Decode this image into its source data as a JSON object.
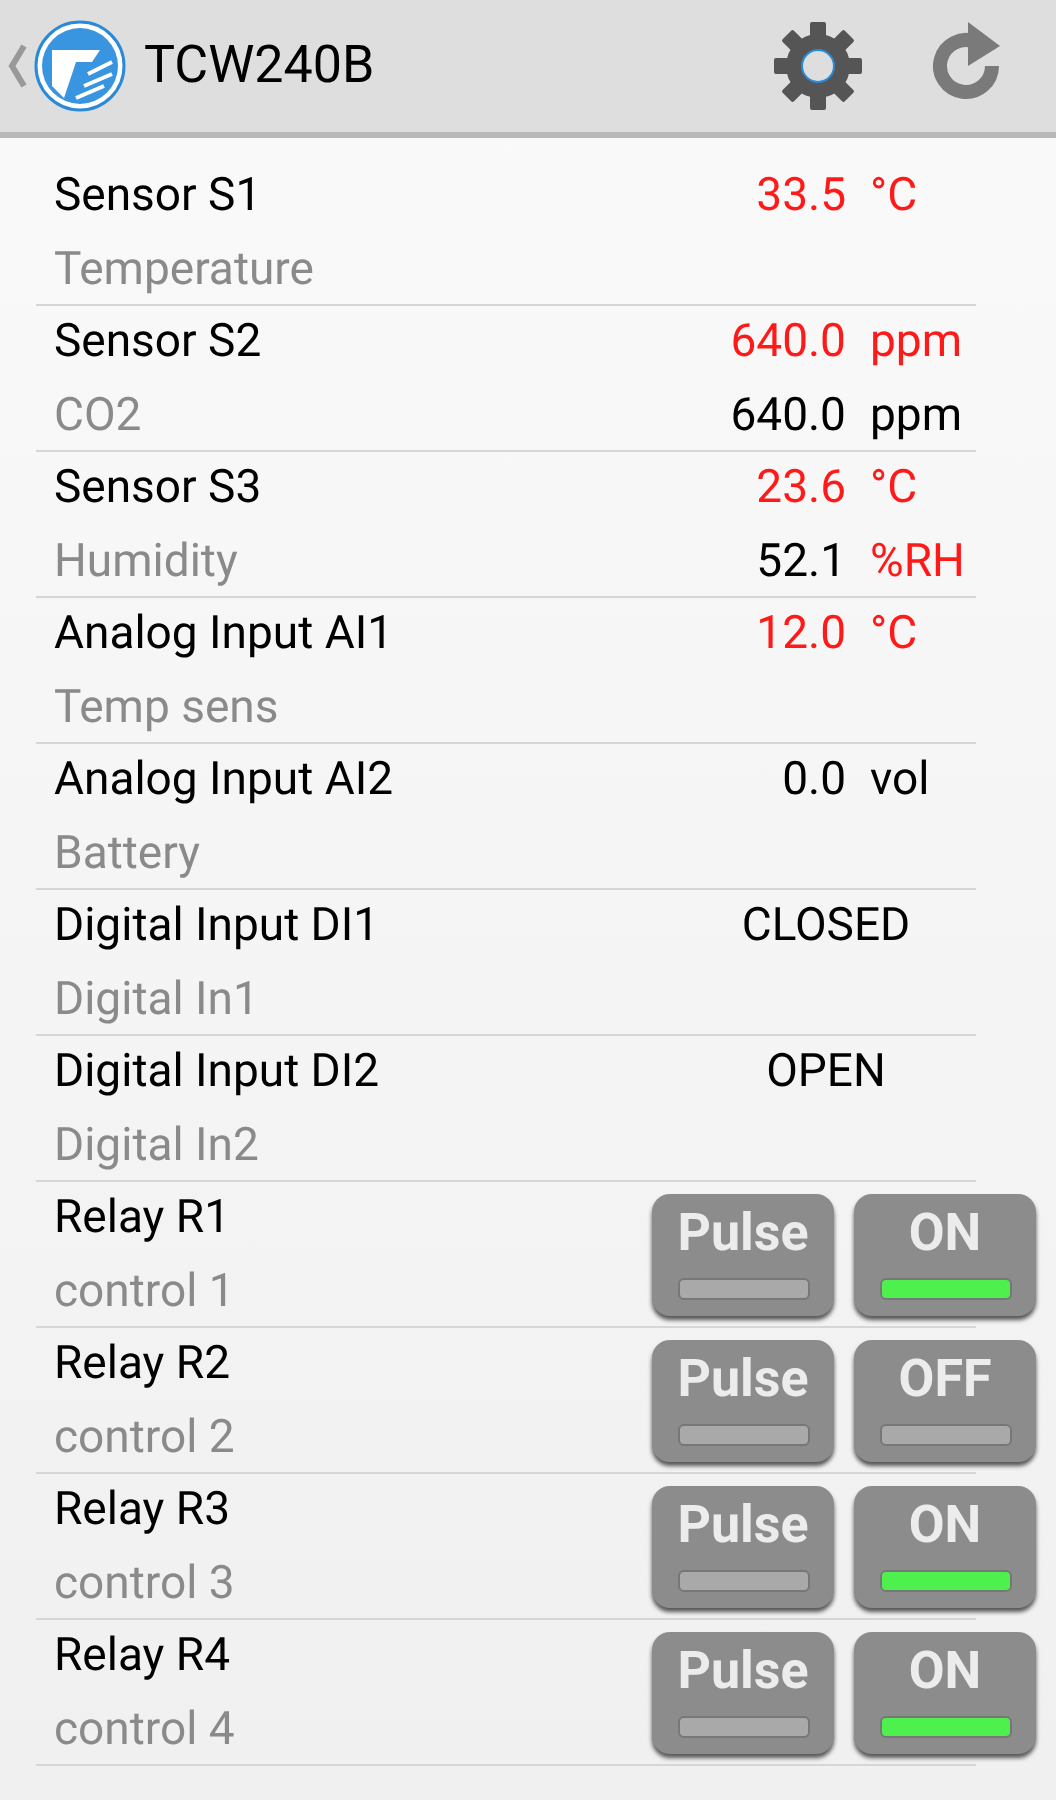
{
  "action_bar": {
    "title": "TCW240B"
  },
  "rows": [
    {
      "kind": "sensor",
      "name": "Sensor S1",
      "description": "Temperature",
      "readings": [
        {
          "value": "33.5",
          "value_alert": true,
          "unit": "°C",
          "unit_alert": true
        }
      ]
    },
    {
      "kind": "sensor",
      "name": "Sensor S2",
      "description": "CO2",
      "readings": [
        {
          "value": "640.0",
          "value_alert": true,
          "unit": "ppm",
          "unit_alert": true
        },
        {
          "value": "640.0",
          "value_alert": false,
          "unit": "ppm",
          "unit_alert": false
        }
      ]
    },
    {
      "kind": "sensor",
      "name": "Sensor S3",
      "description": "Humidity",
      "readings": [
        {
          "value": "23.6",
          "value_alert": true,
          "unit": "°C",
          "unit_alert": true
        },
        {
          "value": "52.1",
          "value_alert": false,
          "unit": "%RH",
          "unit_alert": true
        }
      ]
    },
    {
      "kind": "sensor",
      "name": "Analog Input AI1",
      "description": "Temp sens",
      "readings": [
        {
          "value": "12.0",
          "value_alert": true,
          "unit": "°C",
          "unit_alert": true
        }
      ]
    },
    {
      "kind": "sensor",
      "name": "Analog Input AI2",
      "description": "Battery",
      "readings": [
        {
          "value": "0.0",
          "value_alert": false,
          "unit": "vol",
          "unit_alert": false
        }
      ]
    },
    {
      "kind": "digital",
      "name": "Digital Input DI1",
      "description": "Digital In1",
      "state": "CLOSED"
    },
    {
      "kind": "digital",
      "name": "Digital Input DI2",
      "description": "Digital In2",
      "state": "OPEN"
    },
    {
      "kind": "relay",
      "name": "Relay R1",
      "description": "control 1",
      "pulse": {
        "label": "Pulse",
        "on": false
      },
      "switch": {
        "label": "ON",
        "on": true
      }
    },
    {
      "kind": "relay",
      "name": "Relay R2",
      "description": "control 2",
      "pulse": {
        "label": "Pulse",
        "on": false
      },
      "switch": {
        "label": "OFF",
        "on": false
      }
    },
    {
      "kind": "relay",
      "name": "Relay R3",
      "description": "control 3",
      "pulse": {
        "label": "Pulse",
        "on": false
      },
      "switch": {
        "label": "ON",
        "on": true
      }
    },
    {
      "kind": "relay",
      "name": "Relay R4",
      "description": "control 4",
      "pulse": {
        "label": "Pulse",
        "on": false
      },
      "switch": {
        "label": "ON",
        "on": true
      }
    }
  ]
}
